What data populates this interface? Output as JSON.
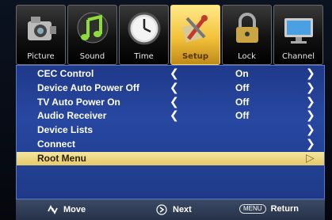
{
  "tabs": [
    {
      "label": "Picture",
      "icon": "camera-icon"
    },
    {
      "label": "Sound",
      "icon": "music-note-icon"
    },
    {
      "label": "Time",
      "icon": "clock-icon"
    },
    {
      "label": "Setup",
      "icon": "wrench-tools-icon"
    },
    {
      "label": "Lock",
      "icon": "padlock-icon"
    },
    {
      "label": "Channel",
      "icon": "monitor-icon"
    }
  ],
  "selected_tab": "Setup",
  "menu": [
    {
      "name": "CEC Control",
      "value": "On"
    },
    {
      "name": "Device Auto Power Off",
      "value": "Off"
    },
    {
      "name": "TV Auto Power On",
      "value": "Off"
    },
    {
      "name": "Audio Receiver",
      "value": "Off"
    },
    {
      "name": "Device Lists",
      "value": ""
    },
    {
      "name": "Connect",
      "value": ""
    },
    {
      "name": "Root Menu",
      "value": ""
    }
  ],
  "highlighted_item": "Root Menu",
  "footer": {
    "move_label": "Move",
    "next_label": "Next",
    "menu_key": "MENU",
    "return_label": "Return"
  },
  "colors": {
    "panel": "#2747a1",
    "highlight": "#e6c867",
    "selected_tab": "#f3c23a"
  }
}
